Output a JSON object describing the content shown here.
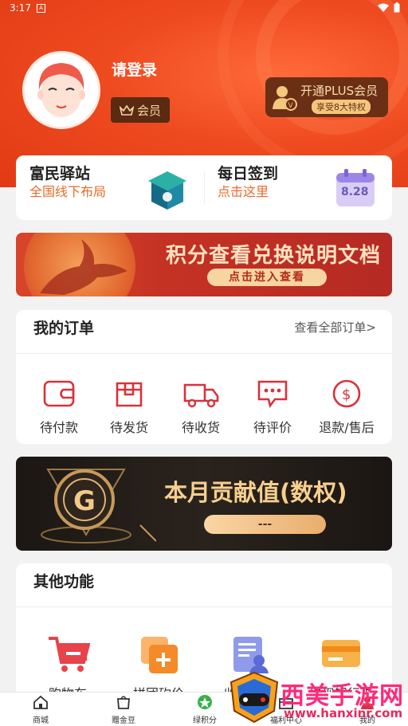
{
  "status_bar": {
    "time": "3:17",
    "sim_label": "A"
  },
  "profile": {
    "login_label": "请登录",
    "member_label": "会员"
  },
  "plus": {
    "title": "开通PLUS会员",
    "subtitle": "享受8大特权"
  },
  "quick": {
    "station": {
      "title": "富民驿站",
      "subtitle": "全国线下布局"
    },
    "signin": {
      "title": "每日签到",
      "subtitle": "点击这里",
      "date": "8.28"
    }
  },
  "banner_points": {
    "title": "积分查看兑换说明文档",
    "button": "点击进入查看"
  },
  "orders": {
    "title": "我的订单",
    "view_all": "查看全部订单>",
    "items": [
      {
        "label": "待付款",
        "icon": "wallet-icon"
      },
      {
        "label": "待发货",
        "icon": "box-icon"
      },
      {
        "label": "待收货",
        "icon": "truck-icon"
      },
      {
        "label": "待评价",
        "icon": "comment-icon"
      },
      {
        "label": "退款/售后",
        "icon": "refund-icon"
      }
    ]
  },
  "banner_contribution": {
    "title": "本月贡献值(数权)",
    "value": "---",
    "logo_letter": "G"
  },
  "other": {
    "title": "其他功能",
    "items": [
      {
        "label": "购物车",
        "icon": "cart-icon"
      },
      {
        "label": "拼团砍价",
        "icon": "group-buy-icon"
      },
      {
        "label": "收货地址",
        "icon": "address-icon"
      },
      {
        "label": "提现银行卡",
        "icon": "bank-card-icon"
      }
    ]
  },
  "tabbar": {
    "items": [
      {
        "label": "商城",
        "icon": "home-icon"
      },
      {
        "label": "赠金豆",
        "icon": "bag-icon"
      },
      {
        "label": "绿积分",
        "icon": "green-points-icon"
      },
      {
        "label": "福利中心",
        "icon": "welfare-icon"
      },
      {
        "label": "我的",
        "icon": "user-icon"
      }
    ]
  },
  "watermark": {
    "text": "西美手游网",
    "url": "www.hanxinr.com"
  },
  "colors": {
    "primary": "#e13a14",
    "accent_orange": "#ea6a2a",
    "order_icon": "#d9323a",
    "gold": "#f7cf8e"
  }
}
